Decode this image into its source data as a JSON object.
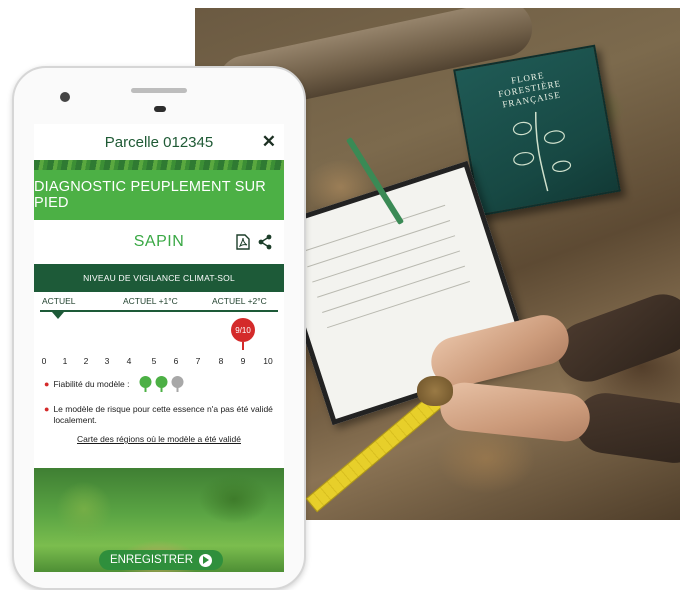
{
  "phone": {
    "title": "Parcelle 012345",
    "banner": "DIAGNOSTIC PEUPLEMENT SUR PIED",
    "species": "SAPIN",
    "vigilance_header": "NIVEAU DE VIGILANCE CLIMAT-SOL",
    "tabs": [
      {
        "label": "ACTUEL",
        "selected": true
      },
      {
        "label": "ACTUEL +1°C",
        "selected": false
      },
      {
        "label": "ACTUEL +2°C",
        "selected": false
      }
    ],
    "score": {
      "label": "9/10",
      "value": 9,
      "max": 10
    },
    "scale": [
      "0",
      "1",
      "2",
      "3",
      "4",
      "5",
      "6",
      "7",
      "8",
      "9",
      "10"
    ],
    "reliability": {
      "label": "Fiabilité du modèle :",
      "level": 2,
      "max": 3
    },
    "note": "Le modèle de risque pour cette essence n'a pas été validé localement.",
    "link": "Carte des régions où le modèle a été validé",
    "save": "ENREGISTRER"
  },
  "photo": {
    "book_title": [
      "FLORE",
      "FORESTIÈRE",
      "FRANÇAISE"
    ]
  },
  "colors": {
    "primary_green": "#4cb045",
    "dark_green": "#1d5a38",
    "alert_red": "#d42a2a",
    "title_green": "#1f5a35"
  },
  "icons": [
    "close-icon",
    "pdf-icon",
    "share-icon",
    "tree-icon",
    "play-icon"
  ]
}
